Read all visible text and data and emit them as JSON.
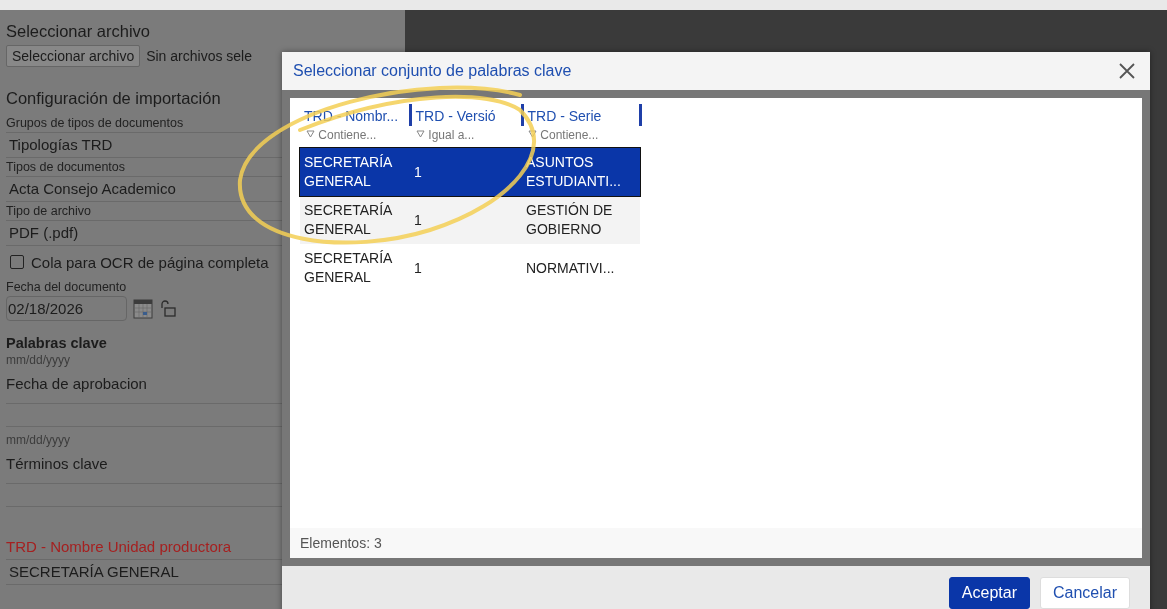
{
  "form": {
    "items": [
      {
        "kind": "heading",
        "text": "Seleccionar archivo"
      },
      {
        "kind": "file",
        "button": "Seleccionar archivo",
        "text": "Sin archivos sele"
      },
      {
        "kind": "heading",
        "text": "Configuración de importación"
      },
      {
        "kind": "label",
        "text": "Grupos de tipos de documentos"
      },
      {
        "kind": "value",
        "text": "Tipologías TRD"
      },
      {
        "kind": "label",
        "text": "Tipos de documentos"
      },
      {
        "kind": "value",
        "text": "Acta Consejo Academico"
      },
      {
        "kind": "label",
        "text": "Tipo de archivo"
      },
      {
        "kind": "value",
        "text": "PDF (.pdf)"
      },
      {
        "kind": "checkbox",
        "text": "Cola para OCR de página completa",
        "checked": false
      },
      {
        "kind": "label",
        "text": "Fecha del documento"
      },
      {
        "kind": "date",
        "text": "02/18/2026"
      },
      {
        "kind": "bold",
        "text": "Palabras clave"
      },
      {
        "kind": "hint",
        "text": "mm/dd/yyyy"
      },
      {
        "kind": "caption",
        "text": "Fecha de aprobacion"
      },
      {
        "kind": "blank"
      },
      {
        "kind": "hint",
        "text": "mm/dd/yyyy"
      },
      {
        "kind": "caption",
        "text": "Términos clave"
      },
      {
        "kind": "blank"
      },
      {
        "kind": "required",
        "text": "TRD - Nombre Unidad productora"
      },
      {
        "kind": "value",
        "text": "SECRETARÍA GENERAL"
      }
    ]
  },
  "dialog": {
    "title": "Seleccionar conjunto de palabras clave",
    "columns": [
      {
        "title": "TRD - Nombr...",
        "filter": "Contiene..."
      },
      {
        "title": "TRD - Versió",
        "filter": "Igual a..."
      },
      {
        "title": "TRD - Serie",
        "filter": "Contiene..."
      }
    ],
    "rows": [
      {
        "cells": [
          "SECRETARÍA GENERAL",
          "1",
          "ASUNTOS ESTUDIANTI..."
        ],
        "selected": true
      },
      {
        "cells": [
          "SECRETARÍA GENERAL",
          "1",
          "GESTIÓN DE GOBIERNO"
        ],
        "selected": false
      },
      {
        "cells": [
          "SECRETARÍA GENERAL",
          "1",
          "NORMATIVI..."
        ],
        "selected": false
      }
    ],
    "count": "Elementos: 3",
    "buttons": [
      {
        "label": "Aceptar",
        "kind": "primary"
      },
      {
        "label": "Cancelar",
        "kind": "secondary"
      }
    ]
  }
}
